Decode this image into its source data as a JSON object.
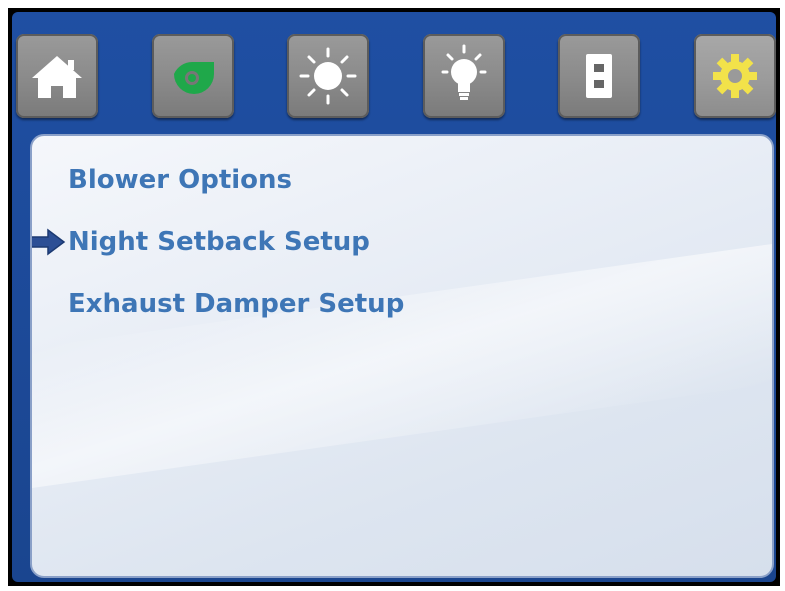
{
  "toolbar": {
    "buttons": [
      {
        "id": "home",
        "icon": "home-icon",
        "color": "#ffffff",
        "active": false
      },
      {
        "id": "blower",
        "icon": "blower-icon",
        "color": "#1fa84a",
        "active": false
      },
      {
        "id": "sun",
        "icon": "sun-icon",
        "color": "#ffffff",
        "active": false
      },
      {
        "id": "light",
        "icon": "light-bulb-icon",
        "color": "#ffffff",
        "active": false
      },
      {
        "id": "switch",
        "icon": "switch-icon",
        "color": "#ffffff",
        "active": false
      },
      {
        "id": "settings",
        "icon": "gear-icon",
        "color": "#f2e24a",
        "active": true
      }
    ]
  },
  "menu": {
    "items": [
      {
        "label": "Blower Options"
      },
      {
        "label": "Night Setback Setup"
      },
      {
        "label": "Exhaust Damper Setup"
      }
    ],
    "selected_index": 1
  },
  "colors": {
    "frame_blue": "#1f4fa3",
    "menu_text": "#3e76b6",
    "arrow": "#2c4f95"
  }
}
